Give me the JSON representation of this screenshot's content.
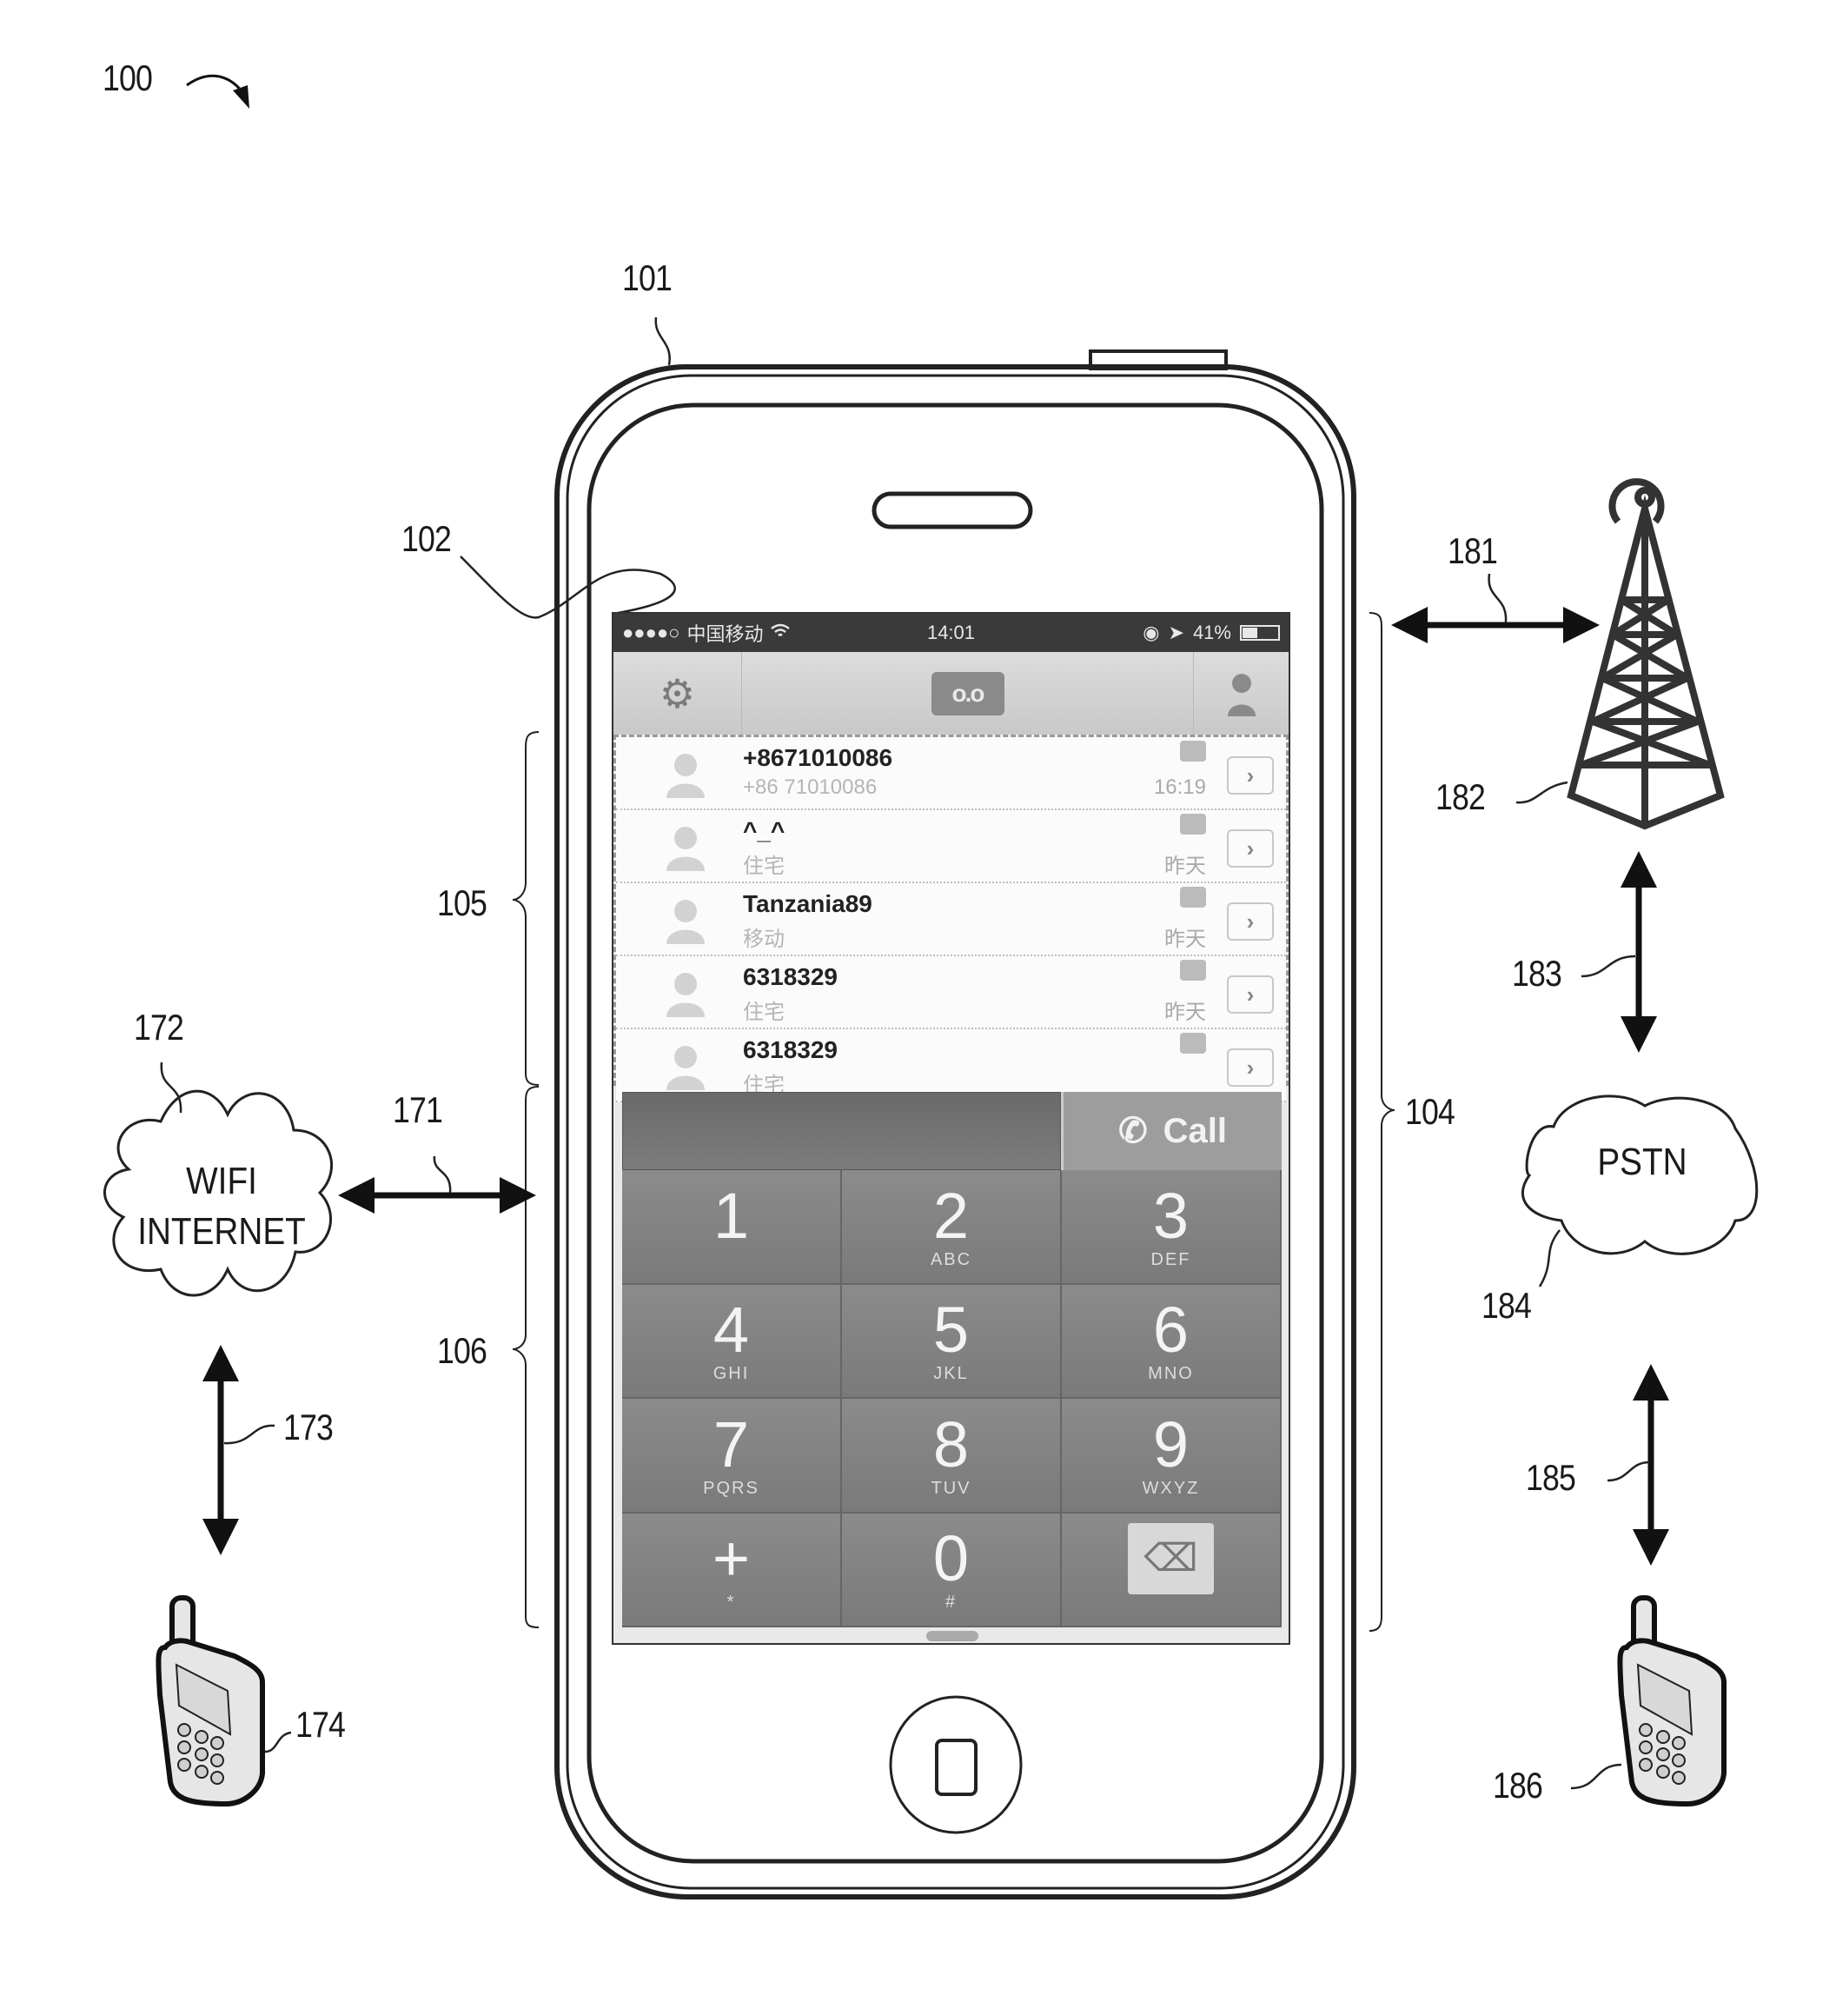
{
  "figure": {
    "ref_main": "100",
    "refs": {
      "device": "101",
      "screen": "102",
      "communication_interface": "104",
      "call_history_region": "105",
      "dialpad_region": "106",
      "link_wifi": "171",
      "wifi_network": "172",
      "link_wifi_phone": "173",
      "wifi_phone": "174",
      "link_tower": "181",
      "cell_tower": "182",
      "link_tower_pstn": "183",
      "pstn_network": "184",
      "link_pstn_phone": "185",
      "pstn_phone": "186"
    },
    "clouds": {
      "wifi_line1": "WIFI",
      "wifi_line2": "INTERNET",
      "pstn": "PSTN"
    }
  },
  "phone_screen": {
    "status_bar": {
      "signal": "●●●●○",
      "carrier": "中国移动",
      "wifi_icon": "wifi-icon",
      "time": "14:01",
      "alarm_icon": "alarm-icon",
      "location_icon": "location-arrow-icon",
      "battery_percent": "41%",
      "battery_level": 0.41
    },
    "toolbar": {
      "settings_icon": "gear-icon",
      "voicemail_label": "o.o",
      "contacts_icon": "person-icon"
    },
    "call_history": [
      {
        "name": "+8671010086",
        "subtitle": "+86 71010086",
        "time": "16:19"
      },
      {
        "name": "^_^",
        "subtitle": "住宅",
        "time": "昨天"
      },
      {
        "name": "Tanzania89",
        "subtitle": "移动",
        "time": "昨天"
      },
      {
        "name": "6318329",
        "subtitle": "住宅",
        "time": "昨天"
      },
      {
        "name": "6318329",
        "subtitle": "住宅",
        "time": ""
      }
    ],
    "dialer": {
      "number_value": "",
      "call_label": "Call",
      "keys": [
        {
          "digit": "1",
          "letters": ""
        },
        {
          "digit": "2",
          "letters": "ABC"
        },
        {
          "digit": "3",
          "letters": "DEF"
        },
        {
          "digit": "4",
          "letters": "GHI"
        },
        {
          "digit": "5",
          "letters": "JKL"
        },
        {
          "digit": "6",
          "letters": "MNO"
        },
        {
          "digit": "7",
          "letters": "PQRS"
        },
        {
          "digit": "8",
          "letters": "TUV"
        },
        {
          "digit": "9",
          "letters": "WXYZ"
        },
        {
          "digit": "+",
          "letters": "*"
        },
        {
          "digit": "0",
          "letters": "#"
        },
        {
          "digit": "⌫",
          "letters": ""
        }
      ]
    }
  }
}
